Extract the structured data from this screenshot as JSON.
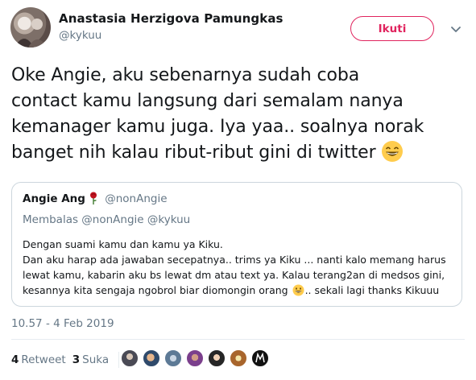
{
  "author": {
    "display_name": "Anastasia Herzigova Pamungkas",
    "handle": "@kykuu"
  },
  "follow_button": {
    "label": "Ikuti"
  },
  "tweet": {
    "lines": [
      "Oke Angie, aku sebenarnya sudah coba",
      "contact kamu langsung dari semalam nanya",
      "kemanager kamu juga. Iya yaa.. soalnya norak",
      "banget nih kalau ribut-ribut gini di twitter"
    ],
    "emoji": "grinning-face-with-smiling-eyes-icon"
  },
  "quote": {
    "name": "Angie Ang",
    "name_emoji": "rose-icon",
    "handle": "@nonAngie",
    "reply_to": "Membalas @nonAngie @kykuu",
    "lines": [
      "Dengan suami kamu dan kamu ya Kiku.",
      "Dan aku harap ada jawaban secepatnya.. trims ya Kiku ... nanti kalo memang harus",
      "lewat kamu, kabarin aku bs lewat dm atau text ya. Kalau terang2an di medsos gini,"
    ],
    "last_line_before": "kesannya kita sengaja ngobrol biar diomongin orang",
    "last_line_after": ".. sekali lagi thanks Kikuuu"
  },
  "timestamp": "10.57 - 4 Feb 2019",
  "stats": {
    "retweet_count": "4",
    "retweet_label": "Retweet",
    "like_count": "3",
    "like_label": "Suka"
  },
  "likers_count": 6,
  "colors": {
    "accent": "#e0245e",
    "text": "#14171a",
    "secondary": "#657786",
    "border": "#ccd6dd"
  }
}
